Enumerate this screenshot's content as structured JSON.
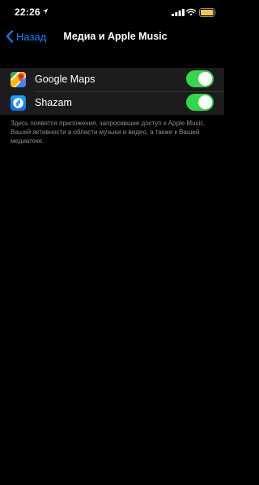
{
  "status_bar": {
    "time": "22:26",
    "icons": [
      "location-arrow-icon",
      "cellular-signal-icon",
      "wifi-icon",
      "battery-icon"
    ],
    "battery_color": "#f5c542"
  },
  "nav": {
    "back_label": "Назад",
    "title": "Медиа и Apple Music",
    "accent_color": "#0a84ff"
  },
  "apps": [
    {
      "label": "Google Maps",
      "icon": "google-maps-icon",
      "enabled": true
    },
    {
      "label": "Shazam",
      "icon": "shazam-icon",
      "enabled": true
    }
  ],
  "toggle_on_color": "#32d74b",
  "footer_note": "Здесь появятся приложения, запросившие доступ к Apple Music, Вашей активности в области музыки и видео, а также к Вашей медиатеке."
}
